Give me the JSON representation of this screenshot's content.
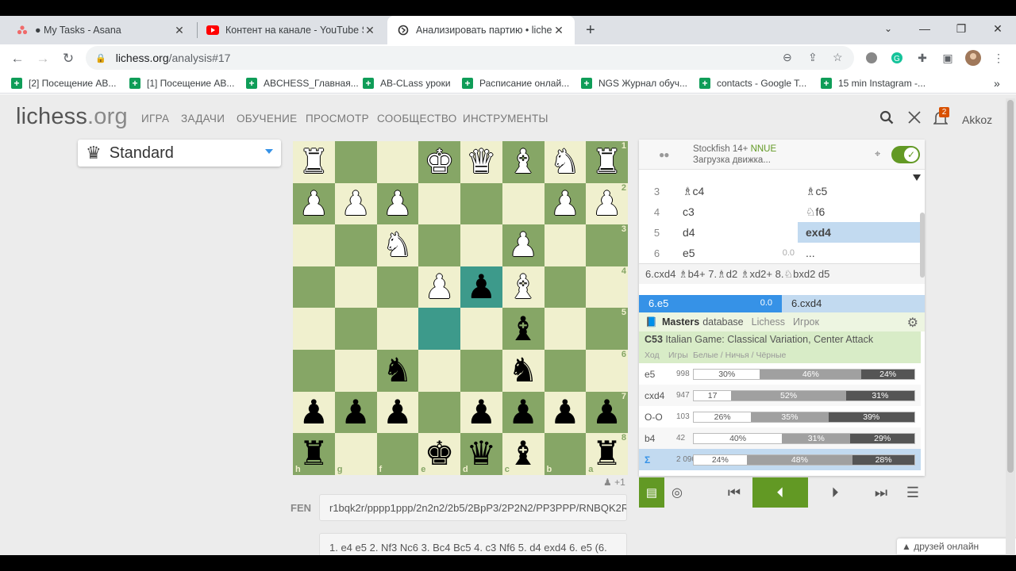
{
  "browser": {
    "tabs": [
      {
        "title": "● My Tasks - Asana",
        "icon": "asana-icon",
        "active": false
      },
      {
        "title": "Контент на канале - YouTube Stu",
        "icon": "youtube-icon",
        "active": false
      },
      {
        "title": "Анализировать партию • lichess",
        "icon": "lichess-icon",
        "active": true
      }
    ],
    "url_host": "lichess.org",
    "url_path": "/analysis#17",
    "bookmarks": [
      "[2] Посещение AB...",
      "[1] Посещение AB...",
      "ABCHESS_Главная...",
      "AB-CLass уроки",
      "Расписание онлай...",
      "NGS Журнал обуч...",
      "contacts - Google T...",
      "15 min Instagram -..."
    ],
    "bookmarks_more": "»"
  },
  "lichess": {
    "logo_main": "lichess",
    "logo_org": ".org",
    "nav": [
      "ИГРА",
      "ЗАДАЧИ",
      "ОБУЧЕНИЕ",
      "ПРОСМОТР",
      "СООБЩЕСТВО",
      "ИНСТРУМЕНТЫ"
    ],
    "notifications": "2",
    "username": "Akkoz",
    "variant": "Standard",
    "plus_one": "+1",
    "fen_label": "FEN",
    "fen": "r1bqk2r/pppp1ppp/2n2n2/2b5/2BpP3/2P2N2/PP3PPP/RNBQK2R",
    "pgn": "1. e4 e5 2. Nf3 Nc6 3. Bc4 Bc5 4. c3 Nf6 5. d4 exd4 6. e5 (6.",
    "friends": "друзей онлайн"
  },
  "engine": {
    "name": "Stockfish 14+",
    "nnue": "NNUE",
    "status": "Загрузка движка...",
    "enabled": true
  },
  "moves": {
    "rows": [
      {
        "n": "3",
        "w": "♗c4",
        "b": "♗c5"
      },
      {
        "n": "4",
        "w": "c3",
        "b": "♘f6"
      },
      {
        "n": "5",
        "w": "d4",
        "b": "exd4"
      },
      {
        "n": "6",
        "w": "e5",
        "w_eval": "0.0",
        "b": "..."
      }
    ],
    "variation": "6.cxd4 ♗b4+ 7.♗d2 ♗xd2+ 8.♘bxd2 d5",
    "current_main": "6.e5",
    "current_eval": "0.0",
    "current_alt": "6.cxd4"
  },
  "explorer": {
    "tab_masters": "Masters",
    "tab_db": "database",
    "tab_lichess": "Lichess",
    "tab_player": "Игрок",
    "eco": "C53",
    "opening": "Italian Game: Classical Variation, Center Attack",
    "head_move": "Ход",
    "head_games": "Игры",
    "head_result": "Белые / Ничья / Чёрные",
    "rows": [
      {
        "move": "e5",
        "games": "998",
        "white": "30%",
        "draw": "46%",
        "black": "24%",
        "w": 30,
        "d": 46,
        "b": 24
      },
      {
        "move": "cxd4",
        "games": "947",
        "white": "17",
        "draw": "52%",
        "black": "31%",
        "w": 17,
        "d": 52,
        "b": 31
      },
      {
        "move": "O-O",
        "games": "103",
        "white": "26%",
        "draw": "35%",
        "black": "39%",
        "w": 26,
        "d": 35,
        "b": 39
      },
      {
        "move": "b4",
        "games": "42",
        "white": "40%",
        "draw": "31%",
        "black": "29%",
        "w": 40,
        "d": 31,
        "b": 29
      },
      {
        "move": "Σ",
        "games": "2 090",
        "white": "24%",
        "draw": "48%",
        "black": "28%",
        "w": 24,
        "d": 48,
        "b": 28
      }
    ]
  },
  "board": {
    "ranks": [
      "1",
      "2",
      "3",
      "4",
      "5",
      "6",
      "7",
      "8"
    ],
    "files": [
      "h",
      "g",
      "f",
      "e",
      "d",
      "c",
      "b",
      "a"
    ],
    "pieces": [
      [
        "wR",
        "",
        "",
        "wK",
        "wQ",
        "wB",
        "wN",
        "wR"
      ],
      [
        "wP",
        "wP",
        "wP",
        "",
        "",
        "",
        "wP",
        "wP"
      ],
      [
        "",
        "",
        "wN",
        "",
        "",
        "wP",
        "",
        ""
      ],
      [
        "",
        "",
        "",
        "wP",
        "bP",
        "wB",
        "",
        ""
      ],
      [
        "",
        "",
        "",
        "",
        "",
        "bB",
        "",
        ""
      ],
      [
        "",
        "",
        "bN",
        "",
        "",
        "bN",
        "",
        ""
      ],
      [
        "bP",
        "bP",
        "bP",
        "",
        "bP",
        "bP",
        "bP",
        "bP"
      ],
      [
        "bR",
        "",
        "",
        "bK",
        "bQ",
        "bB",
        "",
        "bR"
      ]
    ],
    "highlight": [
      [
        3,
        4
      ],
      [
        4,
        3
      ]
    ]
  }
}
